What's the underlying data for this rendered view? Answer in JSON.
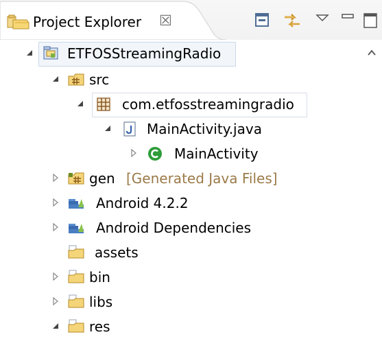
{
  "view": {
    "title": "Project Explorer",
    "close_glyph": "☒"
  },
  "toolbar": {
    "icons": [
      "collapse-all-icon",
      "link-with-editor-icon",
      "view-menu-icon",
      "minimize-icon",
      "maximize-icon"
    ]
  },
  "tree": {
    "rows": [
      {
        "label": "ETFOSStreamingRadio",
        "icon": "android-project-icon",
        "expanded": true
      },
      {
        "label": "src",
        "icon": "source-folder-icon",
        "expanded": true
      },
      {
        "label": "com.etfosstreamingradio",
        "icon": "package-icon",
        "expanded": true
      },
      {
        "label": "MainActivity.java",
        "icon": "java-file-icon",
        "expanded": true
      },
      {
        "label": "MainActivity",
        "icon": "class-icon",
        "expanded": false
      },
      {
        "label": "gen",
        "decoration": "[Generated Java Files]",
        "icon": "generated-folder-icon",
        "expanded": false
      },
      {
        "label": "Android 4.2.2",
        "icon": "library-icon",
        "expanded": false
      },
      {
        "label": "Android Dependencies",
        "icon": "library-icon",
        "expanded": false
      },
      {
        "label": "assets",
        "icon": "folder-icon"
      },
      {
        "label": "bin",
        "icon": "folder-icon",
        "expanded": false
      },
      {
        "label": "libs",
        "icon": "folder-icon",
        "expanded": false
      },
      {
        "label": "res",
        "icon": "folder-icon",
        "expanded": true
      }
    ]
  },
  "colors": {
    "selection_border": "#c9d7e9",
    "decoration_text": "#9b7a48",
    "class_icon": "#2e9c3a"
  }
}
